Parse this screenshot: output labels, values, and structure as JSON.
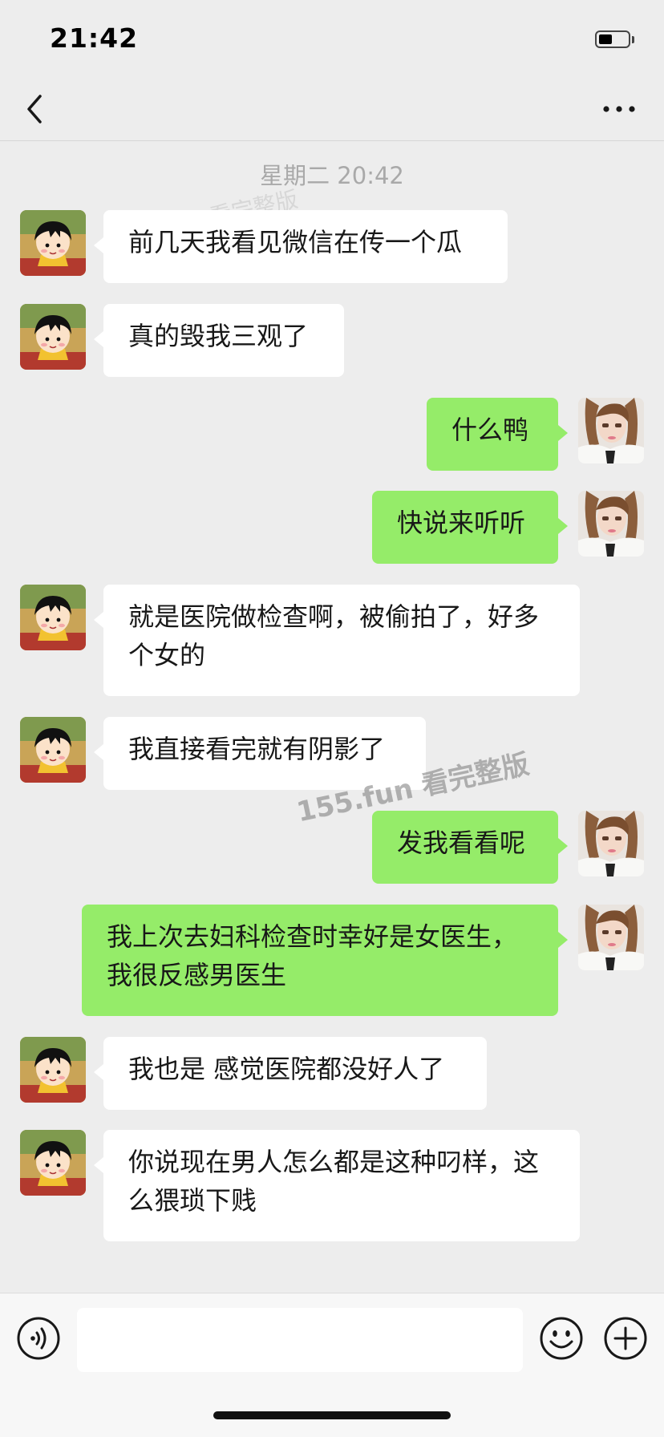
{
  "status_bar": {
    "time": "21:42",
    "battery_icon": "battery-icon"
  },
  "nav": {
    "back_icon": "back-chevron-icon",
    "more_icon": "more-dots-icon"
  },
  "timestamp": "星期二 20:42",
  "watermark": "155.fun 看完整版",
  "watermark_faint": "看完整版",
  "contacts": {
    "other": {
      "avatar": "cartoon-girl-avatar"
    },
    "self": {
      "avatar": "user-photo-avatar"
    }
  },
  "messages": [
    {
      "sender": "other",
      "text": "前几天我看见微信在传一个瓜"
    },
    {
      "sender": "other",
      "text": "真的毁我三观了"
    },
    {
      "sender": "self",
      "text": "什么鸭"
    },
    {
      "sender": "self",
      "text": "快说来听听"
    },
    {
      "sender": "other",
      "text": "就是医院做检查啊，被偷拍了，好多个女的"
    },
    {
      "sender": "other",
      "text": "我直接看完就有阴影了"
    },
    {
      "sender": "self",
      "text": "发我看看呢"
    },
    {
      "sender": "self",
      "text": "我上次去妇科检查时幸好是女医生，我很反感男医生"
    },
    {
      "sender": "other",
      "text": "我也是 感觉医院都没好人了"
    },
    {
      "sender": "other",
      "text": "你说现在男人怎么都是这种叼样，这么猥琐下贱"
    }
  ],
  "input_bar": {
    "voice_icon": "voice-icon",
    "input_value": "",
    "emoji_icon": "emoji-icon",
    "plus_icon": "plus-icon"
  },
  "colors": {
    "background": "#ededed",
    "incoming_bubble": "#ffffff",
    "outgoing_bubble": "#95ec69",
    "timestamp": "#a9a9a9"
  }
}
